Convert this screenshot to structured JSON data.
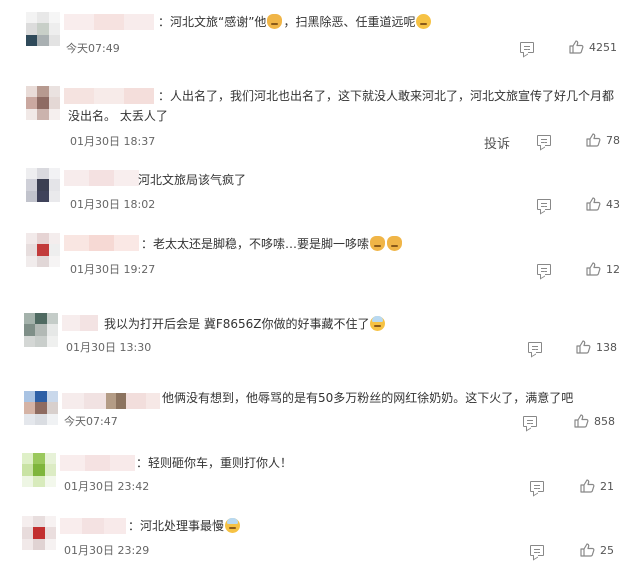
{
  "comments": [
    {
      "text": "：河北文旅“感谢”他",
      "text2": "，扫黑除恶、任重道远呢",
      "time": "今天07:49",
      "likes": "4251"
    },
    {
      "text": "：人出名了，我们河北也出名了，这下就没人敢来河北了，河北文旅宣传了好几个月都",
      "text_line2": "没出名。 太丢人了",
      "time": "01月30日 18:37",
      "likes": "78",
      "report": "投诉"
    },
    {
      "text": "河北文旅局该气疯了",
      "time": "01月30日 18:02",
      "likes": "43"
    },
    {
      "text": "：老太太还是脚稳，不哆嗦…要是脚一哆嗦",
      "time": "01月30日 19:27",
      "likes": "12"
    },
    {
      "text": "我以为打开后会是 冀F8656Z你做的好事藏不住了",
      "time": "01月30日 13:30",
      "likes": "138"
    },
    {
      "text": "他俩没有想到，他辱骂的是有50多万粉丝的网红徐奶奶。这下火了，满意了吧",
      "time": "今天07:47",
      "likes": "858"
    },
    {
      "text": "：轻则砸你车，重则打你人！",
      "time": "01月30日 23:42",
      "likes": "21"
    },
    {
      "text": "：河北处理事最慢",
      "time": "01月30日 23:29",
      "likes": "25"
    }
  ],
  "icons": {
    "reply": "comment-reply-icon",
    "like": "thumbs-up-icon",
    "emoji": "emoji-face-icon"
  },
  "colors": {
    "text": "#333333",
    "meta": "#666666",
    "icon": "#888888"
  }
}
